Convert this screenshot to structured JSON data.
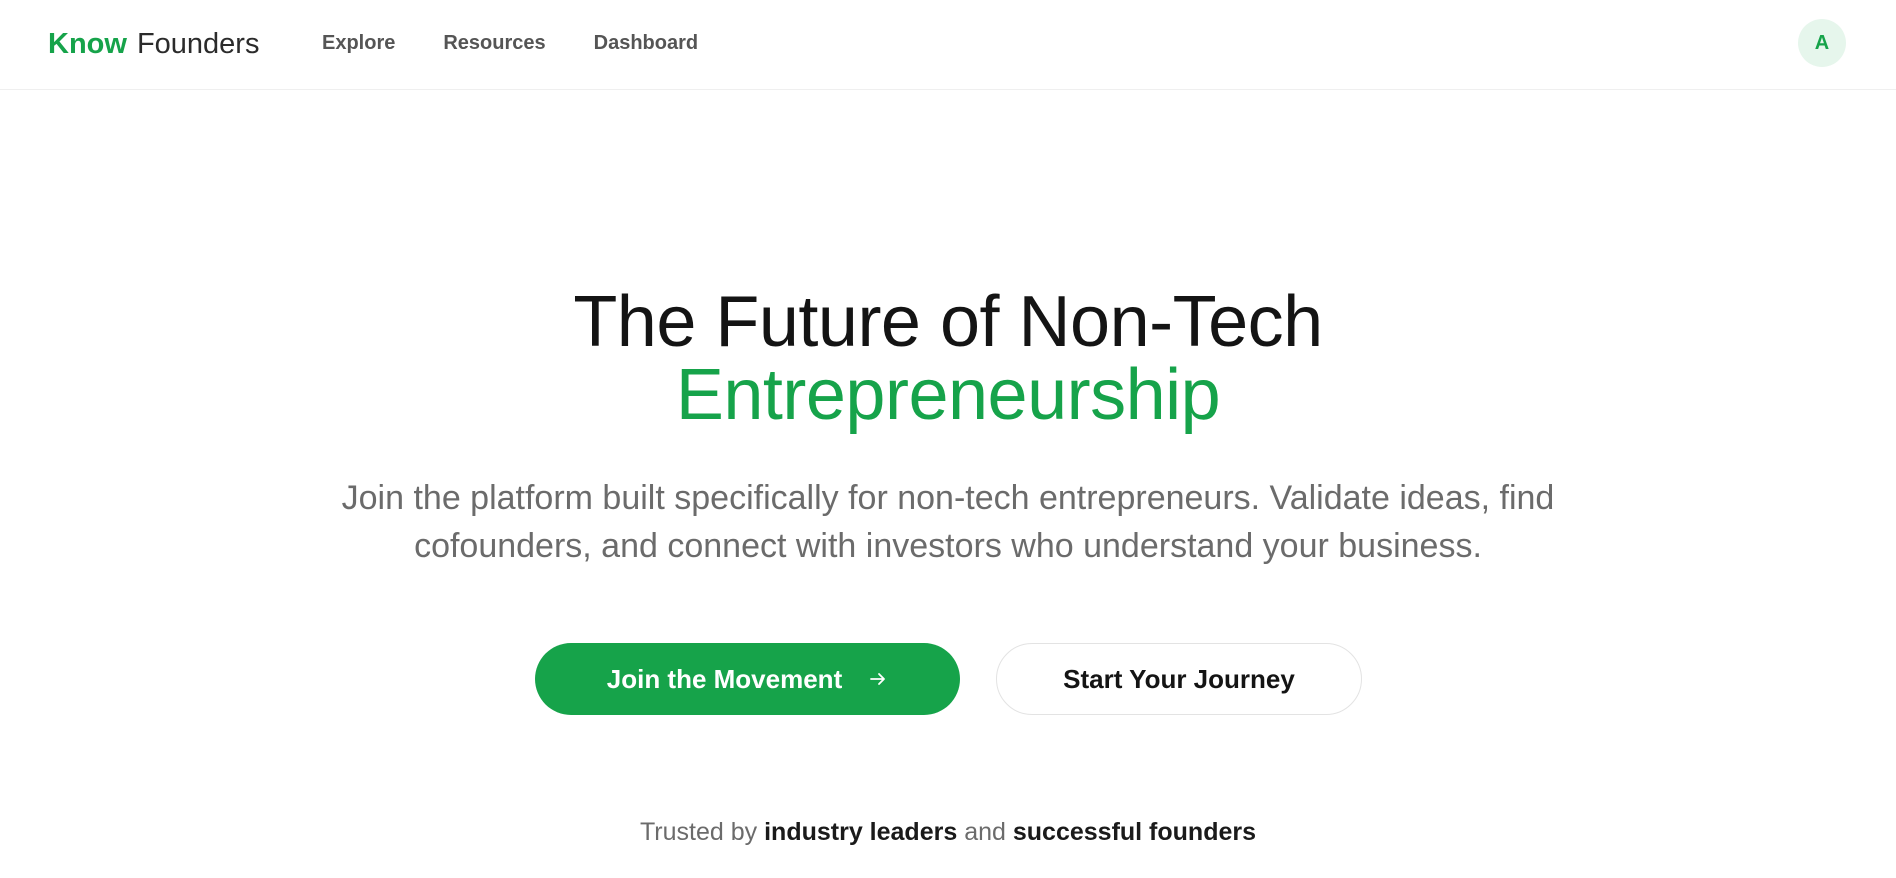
{
  "header": {
    "logo": {
      "part1": "Know",
      "part2": "Founders"
    },
    "nav": [
      {
        "label": "Explore"
      },
      {
        "label": "Resources"
      },
      {
        "label": "Dashboard"
      }
    ],
    "avatar_initial": "A"
  },
  "hero": {
    "title_line1": "The Future of Non-Tech",
    "title_line2": "Entrepreneurship",
    "subtitle": "Join the platform built specifically for non-tech entrepreneurs. Validate ideas, find cofounders, and connect with investors who understand your business.",
    "primary_cta": {
      "label": "Join the Movement",
      "icon": "arrow-right-icon"
    },
    "secondary_cta": {
      "label": "Start Your Journey"
    },
    "trusted": {
      "prefix": "Trusted by",
      "highlight1": "industry leaders",
      "connector": "and",
      "highlight2": "successful founders"
    }
  },
  "colors": {
    "accent": "#16a34a",
    "avatar_bg": "#e6f6ec",
    "text_primary": "#141414",
    "text_muted": "#6b6b6b"
  }
}
